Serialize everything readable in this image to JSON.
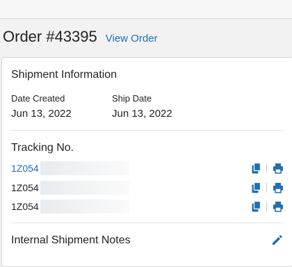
{
  "order": {
    "title": "Order #43395",
    "view_link": "View Order"
  },
  "shipment": {
    "heading": "Shipment Information",
    "date_created_label": "Date Created",
    "date_created_value": "Jun 13, 2022",
    "ship_date_label": "Ship Date",
    "ship_date_value": "Jun 13, 2022",
    "tracking_heading": "Tracking No.",
    "tracking_numbers": [
      "1Z054",
      "1Z054",
      "1Z054"
    ],
    "notes_heading": "Internal Shipment Notes"
  },
  "colors": {
    "accent": "#1f6fb2",
    "background": "#f2f2f2",
    "card": "#ffffff"
  },
  "icons": {
    "copy": "copy-icon",
    "print": "print-icon",
    "edit": "pencil-icon"
  }
}
